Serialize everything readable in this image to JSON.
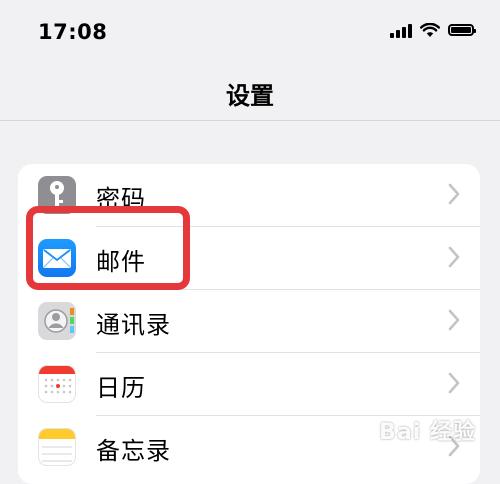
{
  "status_bar": {
    "time": "17:08"
  },
  "nav": {
    "title": "设置"
  },
  "settings": {
    "items": [
      {
        "label": "密码",
        "icon": "key-icon"
      },
      {
        "label": "邮件",
        "icon": "mail-icon"
      },
      {
        "label": "通讯录",
        "icon": "contacts-icon"
      },
      {
        "label": "日历",
        "icon": "calendar-icon"
      },
      {
        "label": "备忘录",
        "icon": "notes-icon"
      }
    ]
  },
  "watermark": {
    "text": "Bai 经验"
  },
  "colors": {
    "highlight": "#e5383b",
    "mail_blue": "#1e88ff",
    "chevron": "#c4c4c7"
  }
}
